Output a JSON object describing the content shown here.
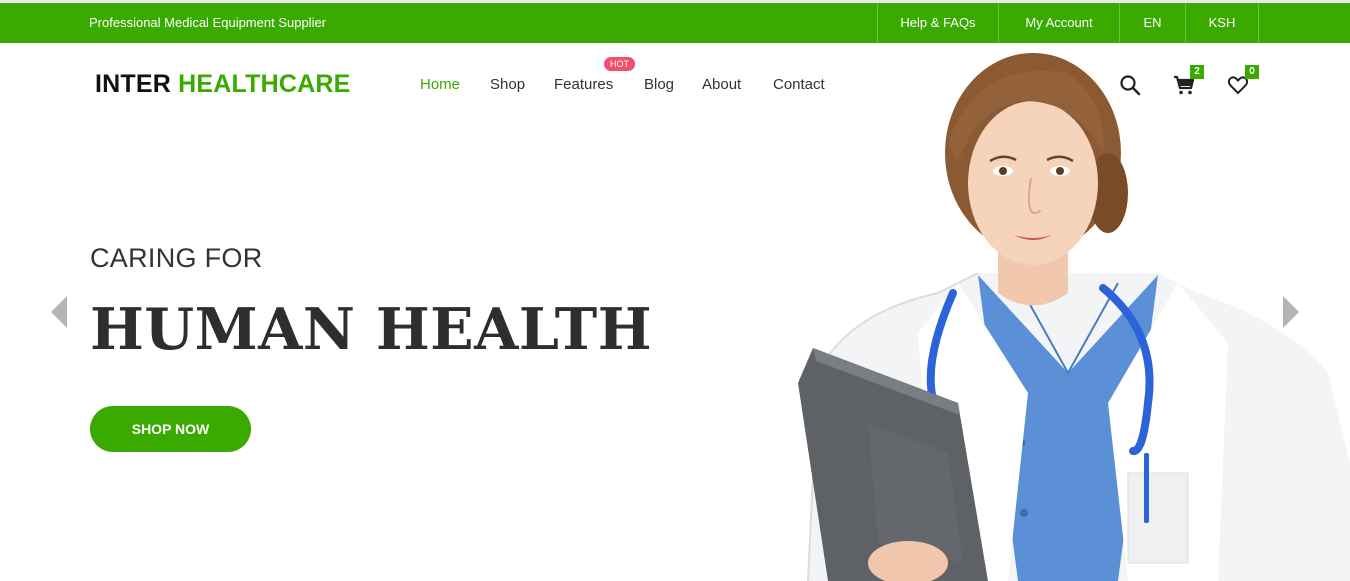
{
  "topbar": {
    "tagline": "Professional Medical Equipment Supplier",
    "links": {
      "help": "Help & FAQs",
      "account": "My Account",
      "language": "EN",
      "currency": "KSH"
    }
  },
  "header": {
    "logo_main": "INTER",
    "logo_accent": "HEALTHCARE",
    "nav": {
      "home": "Home",
      "shop": "Shop",
      "features": "Features",
      "blog": "Blog",
      "about": "About",
      "contact": "Contact"
    },
    "features_badge": "HOT",
    "cart_count": "2",
    "wishlist_count": "0",
    "icons": [
      "search-icon",
      "cart-icon",
      "heart-icon"
    ]
  },
  "hero": {
    "subtitle": "CARING FOR",
    "title": "HUMAN HEALTH",
    "cta": "SHOP NOW",
    "image": "doctor-with-stethoscope-and-clipboard"
  },
  "colors": {
    "brand_green": "#3aaa00",
    "badge_pink": "#f24f6d",
    "text_dark": "#2e2e2e"
  }
}
